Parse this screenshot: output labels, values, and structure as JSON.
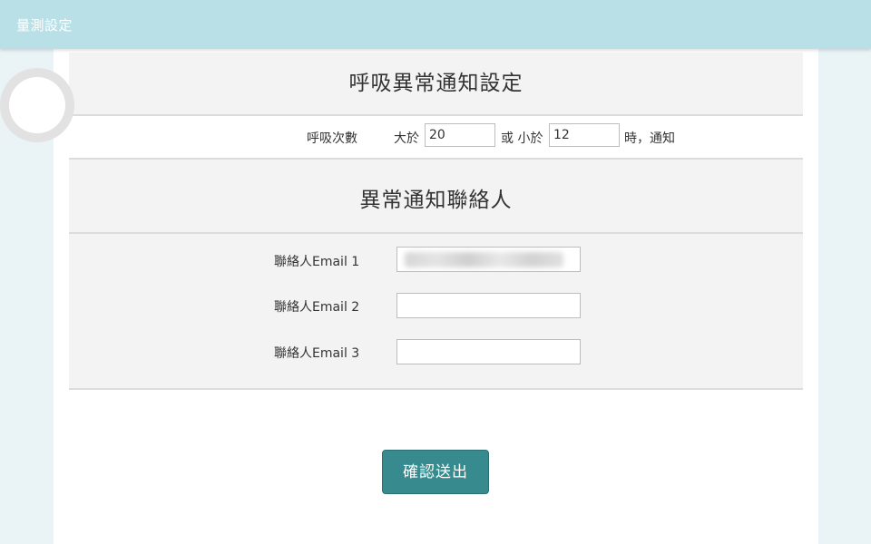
{
  "app": {
    "title": "量測設定"
  },
  "breathing": {
    "section_title": "呼吸異常通知設定",
    "label": "呼吸次數",
    "greater_than_label": "大於",
    "upper_value": "20",
    "or_less_than_label": "或 小於",
    "lower_value": "12",
    "suffix": "時，通知"
  },
  "contacts": {
    "section_title": "異常通知聯絡人",
    "items": [
      {
        "label": "聯絡人Email 1",
        "value": ""
      },
      {
        "label": "聯絡人Email 2",
        "value": ""
      },
      {
        "label": "聯絡人Email 3",
        "value": ""
      }
    ]
  },
  "actions": {
    "submit_label": "確認送出"
  },
  "colors": {
    "topbar": "#b9e0e7",
    "accent_button": "#378a8e",
    "section_background": "#f3f3f3"
  }
}
